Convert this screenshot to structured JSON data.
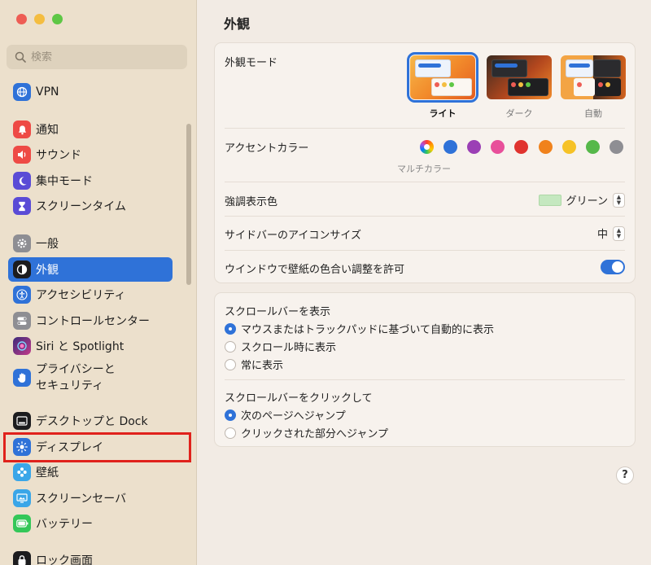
{
  "sidebar": {
    "search_placeholder": "検索",
    "items": [
      {
        "label": "VPN",
        "icon": "globe-icon",
        "color": "#2f72d8"
      },
      {
        "label": "通知",
        "icon": "bell-icon",
        "color": "#ee4a45"
      },
      {
        "label": "サウンド",
        "icon": "speaker-icon",
        "color": "#ee4a45"
      },
      {
        "label": "集中モード",
        "icon": "moon-icon",
        "color": "#5a4bd6"
      },
      {
        "label": "スクリーンタイム",
        "icon": "hourglass-icon",
        "color": "#5a4bd6"
      },
      {
        "label": "一般",
        "icon": "gear-icon",
        "color": "#8e8e93"
      },
      {
        "label": "外観",
        "icon": "appearance-icon",
        "color": "#1c1c1e"
      },
      {
        "label": "アクセシビリティ",
        "icon": "accessibility-icon",
        "color": "#2f72d8"
      },
      {
        "label": "コントロールセンター",
        "icon": "toggles-icon",
        "color": "#8e8e93"
      },
      {
        "label": "Siri と Spotlight",
        "icon": "siri-icon",
        "color": "#7b4bd6"
      },
      {
        "label": "プライバシーと\nセキュリティ",
        "icon": "hand-icon",
        "color": "#2f72d8"
      },
      {
        "label": "デスクトップと Dock",
        "icon": "dock-icon",
        "color": "#1c1c1e"
      },
      {
        "label": "ディスプレイ",
        "icon": "sun-icon",
        "color": "#2f72d8"
      },
      {
        "label": "壁紙",
        "icon": "flower-icon",
        "color": "#3aa6e8"
      },
      {
        "label": "スクリーンセーバ",
        "icon": "screensaver-icon",
        "color": "#3aa6e8"
      },
      {
        "label": "バッテリー",
        "icon": "battery-icon",
        "color": "#34c759"
      },
      {
        "label": "ロック画面",
        "icon": "lock-icon",
        "color": "#1c1c1e"
      }
    ]
  },
  "main": {
    "title": "外観",
    "appearance": {
      "label": "外観モード",
      "options": [
        {
          "label": "ライト",
          "selected": true
        },
        {
          "label": "ダーク",
          "selected": false
        },
        {
          "label": "自動",
          "selected": false
        }
      ]
    },
    "accent": {
      "label": "アクセントカラー",
      "selected_label": "マルチカラー",
      "colors": [
        "#2f72d8",
        "#9b3fb5",
        "#e84f9a",
        "#e0332f",
        "#f0821c",
        "#f6c226",
        "#56b84a",
        "#8e8e93"
      ]
    },
    "highlight": {
      "label": "強調表示色",
      "value": "グリーン"
    },
    "sidebar_icon_size": {
      "label": "サイドバーのアイコンサイズ",
      "value": "中"
    },
    "wallpaper_tint": {
      "label": "ウインドウで壁紙の色合い調整を許可",
      "on": true
    },
    "scroll_show": {
      "label": "スクロールバーを表示",
      "options": [
        {
          "label": "マウスまたはトラックパッドに基づいて自動的に表示",
          "selected": true
        },
        {
          "label": "スクロール時に表示",
          "selected": false
        },
        {
          "label": "常に表示",
          "selected": false
        }
      ]
    },
    "scroll_click": {
      "label": "スクロールバーをクリックして",
      "options": [
        {
          "label": "次のページへジャンプ",
          "selected": true
        },
        {
          "label": "クリックされた部分へジャンプ",
          "selected": false
        }
      ]
    },
    "help_label": "?"
  }
}
